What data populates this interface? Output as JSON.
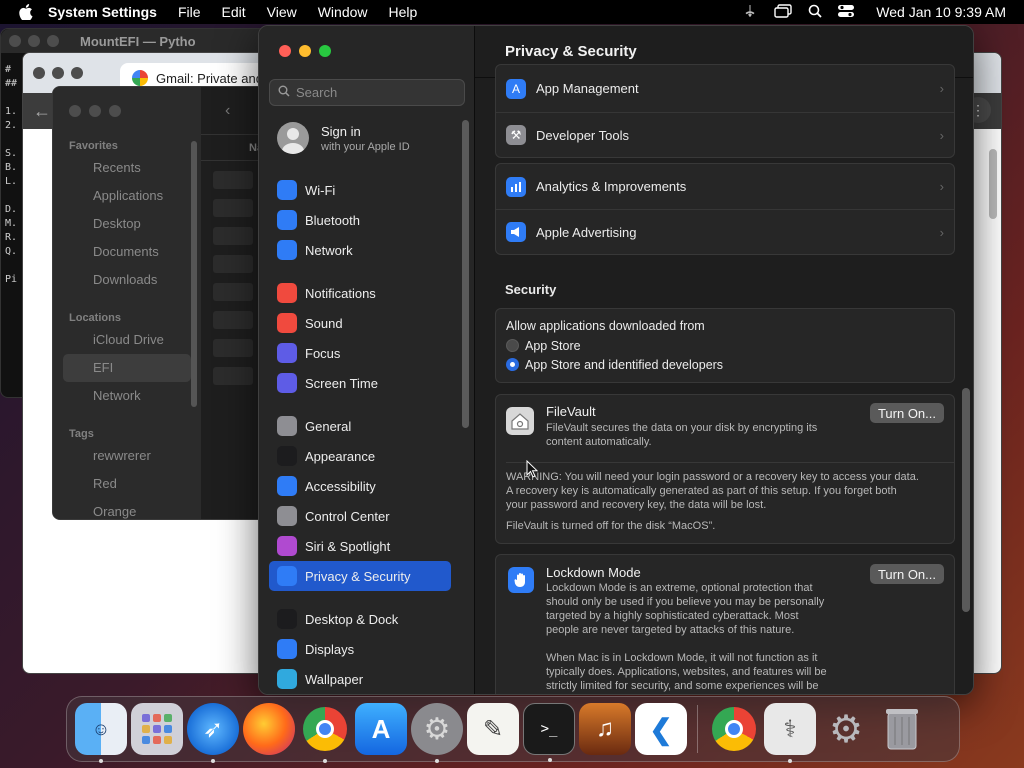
{
  "menubar": {
    "app_name": "System Settings",
    "items": [
      "File",
      "Edit",
      "View",
      "Window",
      "Help"
    ],
    "clock": "Wed Jan 10  9:39 AM"
  },
  "terminal": {
    "title": "MountEFI — Pytho",
    "lines": [
      "#",
      "##",
      "",
      "1.",
      "2.",
      "",
      "S.",
      "B.",
      "L.",
      "",
      "D.",
      "M.",
      "R.",
      "Q.",
      "",
      "Pi"
    ]
  },
  "chrome": {
    "tab_title": "Gmail: Private and"
  },
  "finder": {
    "favorites_header": "Favorites",
    "favorites": [
      "Recents",
      "Applications",
      "Desktop",
      "Documents",
      "Downloads"
    ],
    "locations_header": "Locations",
    "locations": [
      "iCloud Drive",
      "EFI",
      "Network"
    ],
    "tags_header": "Tags",
    "tags": [
      "rewwrerer",
      "Red",
      "Orange"
    ],
    "column_header": "Na"
  },
  "settings": {
    "search_placeholder": "Search",
    "signin": {
      "title": "Sign in",
      "subtitle": "with your Apple ID"
    },
    "sidebar": [
      {
        "label": "Wi-Fi",
        "icon": "wifi-icon",
        "color": "#2f7cf6"
      },
      {
        "label": "Bluetooth",
        "icon": "bluetooth-icon",
        "color": "#2f7cf6"
      },
      {
        "label": "Network",
        "icon": "globe-icon",
        "color": "#2f7cf6"
      },
      {
        "label": "Notifications",
        "icon": "bell-icon",
        "color": "#f04a3e"
      },
      {
        "label": "Sound",
        "icon": "speaker-icon",
        "color": "#f04a3e"
      },
      {
        "label": "Focus",
        "icon": "moon-icon",
        "color": "#5e5ce6"
      },
      {
        "label": "Screen Time",
        "icon": "hourglass-icon",
        "color": "#5e5ce6"
      },
      {
        "label": "General",
        "icon": "gear-icon",
        "color": "#8e8e93"
      },
      {
        "label": "Appearance",
        "icon": "appearance-icon",
        "color": "#1c1c1e"
      },
      {
        "label": "Accessibility",
        "icon": "accessibility-icon",
        "color": "#2f7cf6"
      },
      {
        "label": "Control Center",
        "icon": "control-center-icon",
        "color": "#8e8e93"
      },
      {
        "label": "Siri & Spotlight",
        "icon": "siri-icon",
        "color": "#b04ad0"
      },
      {
        "label": "Privacy & Security",
        "icon": "hand-icon",
        "color": "#2f7cf6"
      },
      {
        "label": "Desktop & Dock",
        "icon": "dock-icon",
        "color": "#1c1c1e"
      },
      {
        "label": "Displays",
        "icon": "sun-icon",
        "color": "#2f7cf6"
      },
      {
        "label": "Wallpaper",
        "icon": "wallpaper-icon",
        "color": "#30a9de"
      }
    ],
    "page_title": "Privacy & Security",
    "rows_top": [
      "App Management",
      "Developer Tools"
    ],
    "rows_mid": [
      "Analytics & Improvements",
      "Apple Advertising"
    ],
    "security_header": "Security",
    "allow_apps": {
      "label": "Allow applications downloaded from",
      "options": [
        "App Store",
        "App Store and identified developers"
      ],
      "selected": "App Store and identified developers"
    },
    "filevault": {
      "title": "FileVault",
      "desc1": "FileVault secures the data on your disk by encrypting its",
      "desc2": "content automatically.",
      "warning1": "WARNING: You will need your login password or a recovery key to access your data.",
      "warning2": "A recovery key is automatically generated as part of this setup. If you forget both",
      "warning3": "your password and recovery key, the data will be lost.",
      "status": "FileVault is turned off for the disk “MacOS”.",
      "button": "Turn On..."
    },
    "lockdown": {
      "title": "Lockdown Mode",
      "p1": [
        "Lockdown Mode is an extreme, optional protection that",
        "should only be used if you believe you may be personally",
        "targeted by a highly sophisticated cyberattack. Most",
        "people are never targeted by attacks of this nature."
      ],
      "p2": [
        "When Mac is in Lockdown Mode, it will not function as it",
        "typically does. Applications, websites, and features will be",
        "strictly limited for security, and some experiences will be"
      ],
      "button": "Turn On..."
    }
  },
  "dock": {
    "apps": [
      "Finder",
      "Launchpad",
      "Safari",
      "Firefox",
      "Chrome",
      "App Store",
      "System Settings",
      "TextEdit",
      "Terminal",
      "GarageBand",
      "VS Code",
      "Chrome",
      "Disk Utility",
      "Settings",
      "Trash"
    ]
  }
}
